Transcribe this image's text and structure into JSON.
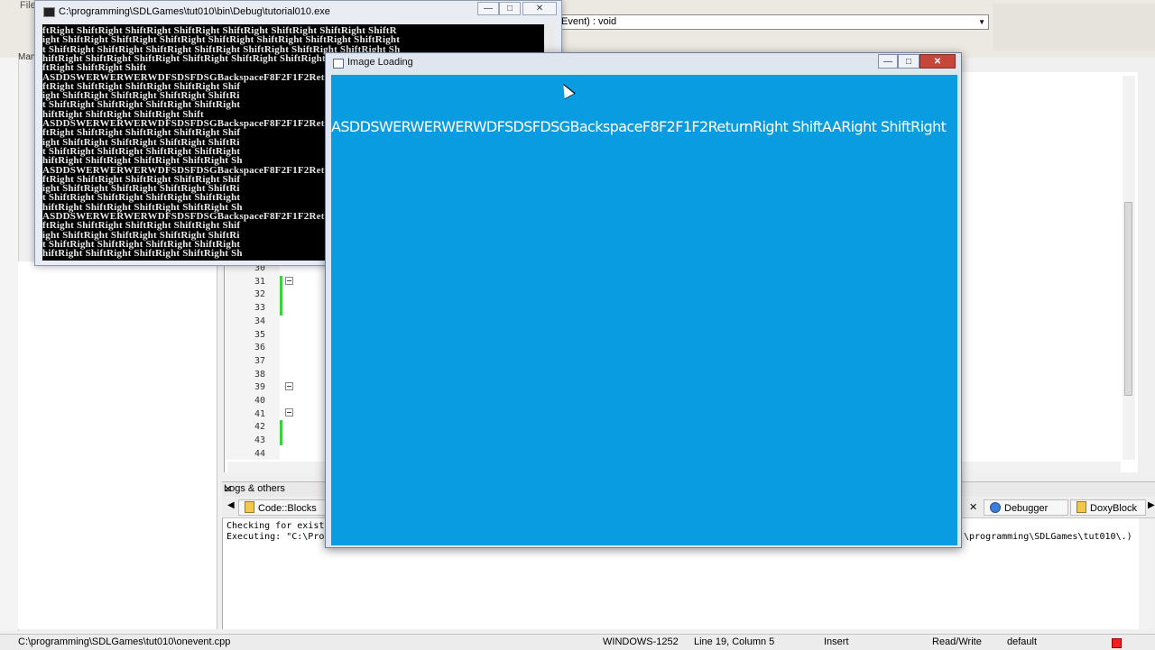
{
  "ide": {
    "menu_file": "File",
    "manage_label": "Mana",
    "function_combo": "Event) : void",
    "line_numbers": [
      "30",
      "31",
      "32",
      "33",
      "34",
      "35",
      "36",
      "37",
      "38",
      "39",
      "40",
      "41",
      "42",
      "43",
      "44"
    ]
  },
  "logs": {
    "title": "Logs & others",
    "tabs": [
      {
        "label": "Code::Blocks",
        "icon": "codeblocks-icon"
      },
      {
        "label": "Debugger",
        "icon": "debugger-icon"
      },
      {
        "label": "DoxyBlock",
        "icon": "doxyblocks-icon"
      }
    ],
    "lines": [
      "Checking for exist",
      "Executing: \"C:\\Pro"
    ],
    "right_text": "\\programming\\SDLGames\\tut010\\.)"
  },
  "status_bar": {
    "file_path": "C:\\programming\\SDLGames\\tut010\\onevent.cpp",
    "encoding": "WINDOWS-1252",
    "position": "Line 19, Column 5",
    "mode": "Insert",
    "access": "Read/Write",
    "profile": "default"
  },
  "console": {
    "title": "C:\\programming\\SDLGames\\tut010\\bin\\Debug\\tutorial010.exe",
    "lines": [
      "ftRight ShiftRight ShiftRight ShiftRight ShiftRight ShiftRight ShiftRight ShiftR",
      "ight ShiftRight ShiftRight ShiftRight ShiftRight ShiftRight ShiftRight ShiftRight",
      "t ShiftRight ShiftRight ShiftRight ShiftRight ShiftRight ShiftRight ShiftRight Sh",
      "hiftRight ShiftRight ShiftRight ShiftRight ShiftRight ShiftRight ShiftRight Shift",
      "ftRight ShiftRight Shift",
      "ASDDSWERWERWERWDFSDSFDSGBackspaceF8F2F1F2Retu",
      "ftRight ShiftRight ShiftRight ShiftRight Shif",
      "ight ShiftRight ShiftRight ShiftRight ShiftRi",
      "t ShiftRight ShiftRight ShiftRight ShiftRight",
      "hiftRight ShiftRight ShiftRight Shift",
      "ASDDSWERWERWERWDFSDSFDSGBackspaceF8F2F1F2Retu",
      "ftRight ShiftRight ShiftRight ShiftRight Shif",
      "ight ShiftRight ShiftRight ShiftRight ShiftRi",
      "t ShiftRight ShiftRight ShiftRight ShiftRight",
      "hiftRight ShiftRight ShiftRight ShiftRight Sh",
      "ASDDSWERWERWERWDFSDSFDSGBackspaceF8F2F1F2Retu",
      "ftRight ShiftRight ShiftRight ShiftRight Shif",
      "ight ShiftRight ShiftRight ShiftRight ShiftRi",
      "t ShiftRight ShiftRight ShiftRight ShiftRight",
      "hiftRight ShiftRight ShiftRight ShiftRight Sh",
      "ASDDSWERWERWERWDFSDSFDSGBackspaceF8F2F1F2Retu",
      "ftRight ShiftRight ShiftRight ShiftRight Shif",
      "ight ShiftRight ShiftRight ShiftRight ShiftRi",
      "t ShiftRight ShiftRight ShiftRight ShiftRight",
      "hiftRight ShiftRight ShiftRight ShiftRight Sh"
    ]
  },
  "image_window": {
    "title": "Image Loading",
    "canvas_text": "ASDDSWERWERWERWDFSDSFDSGBackspaceF8F2F1F2ReturnRight ShiftAARight ShiftRight",
    "background_color": "#0a9ce0"
  }
}
